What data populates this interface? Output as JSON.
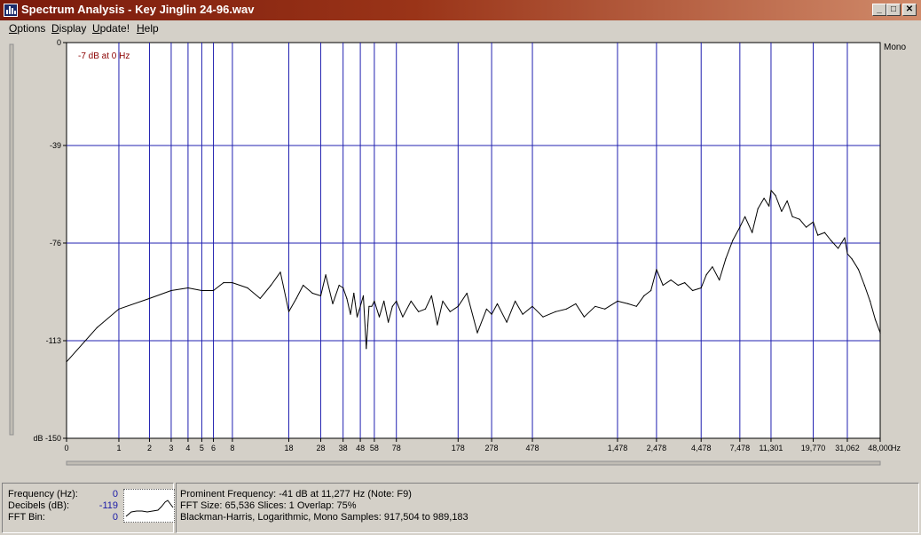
{
  "window": {
    "title": "Spectrum Analysis - Key Jinglin 24-96.wav",
    "minimize_glyph": "_",
    "maximize_glyph": "□",
    "close_glyph": "✕"
  },
  "menu": [
    {
      "label": "Options",
      "accel": "O",
      "rest": "ptions"
    },
    {
      "label": "Display",
      "accel": "D",
      "rest": "isplay"
    },
    {
      "label": "Update!",
      "accel": "U",
      "rest": "pdate!"
    },
    {
      "label": "Help",
      "accel": "H",
      "rest": "elp"
    }
  ],
  "plot": {
    "channel_label": "Mono",
    "annotation": "-7 dB at 0 Hz",
    "annotation_color": "#8b0000",
    "grid_color": "#2020b0",
    "line_color": "#000000",
    "background": "#ffffff"
  },
  "chart_data": {
    "type": "line",
    "title": "",
    "xlabel": "Hz",
    "ylabel": "dB",
    "x_scale": "log",
    "ylim": [
      -150,
      0
    ],
    "y_ticks": [
      0,
      -39,
      -76,
      -113,
      -150
    ],
    "y_tick_labels": [
      "0",
      "-39",
      "-76",
      "-113",
      "dB -150"
    ],
    "x_ticks": [
      0,
      1,
      2,
      3,
      4,
      5,
      6,
      8,
      18,
      28,
      38,
      48,
      58,
      78,
      178,
      278,
      478,
      1478,
      2478,
      4478,
      7478,
      11301,
      19770,
      31062,
      48000
    ],
    "x_tick_labels": [
      "0",
      "1",
      "2",
      "3",
      "4",
      "5",
      "6",
      "8",
      "18",
      "28",
      "38",
      "48",
      "58",
      "78",
      "178",
      "278",
      "478",
      "1,478",
      "2,478",
      "4,478",
      "7,478",
      "11,301",
      "19,770",
      "31,062",
      "48,000"
    ],
    "series": [
      {
        "x": [
          0,
          0.5,
          1,
          2,
          3,
          4,
          5,
          6,
          7,
          8,
          10,
          12,
          14,
          16,
          18,
          20,
          22,
          25,
          28,
          30,
          33,
          36,
          38,
          40,
          42,
          44,
          46,
          48,
          50,
          52,
          54,
          56,
          58,
          62,
          66,
          70,
          74,
          78,
          85,
          95,
          105,
          115,
          125,
          135,
          145,
          160,
          178,
          200,
          230,
          260,
          278,
          300,
          340,
          380,
          420,
          478,
          550,
          650,
          750,
          850,
          950,
          1100,
          1250,
          1478,
          1700,
          1900,
          2100,
          2300,
          2478,
          2700,
          3000,
          3300,
          3600,
          4000,
          4478,
          4800,
          5200,
          5700,
          6200,
          6800,
          7478,
          8000,
          8800,
          9500,
          10300,
          11000,
          11301,
          12000,
          13000,
          14000,
          15000,
          16500,
          18000,
          19770,
          21000,
          23000,
          25000,
          27500,
          30000,
          31062,
          33000,
          36000,
          39000,
          42000,
          45000,
          48000
        ],
        "values": [
          -121,
          -108,
          -101,
          -97,
          -94,
          -93,
          -94,
          -94,
          -91,
          -91,
          -93,
          -97,
          -92,
          -87,
          -102,
          -97,
          -92,
          -95,
          -96,
          -88,
          -99,
          -92,
          -93,
          -97,
          -103,
          -95,
          -104,
          -100,
          -96,
          -116,
          -100,
          -100,
          -98,
          -104,
          -98,
          -106,
          -100,
          -98,
          -104,
          -98,
          -102,
          -101,
          -96,
          -107,
          -98,
          -102,
          -100,
          -95,
          -110,
          -101,
          -103,
          -99,
          -106,
          -98,
          -103,
          -100,
          -104,
          -102,
          -101,
          -99,
          -104,
          -100,
          -101,
          -98,
          -99,
          -100,
          -96,
          -94,
          -86,
          -92,
          -90,
          -92,
          -91,
          -94,
          -93,
          -88,
          -85,
          -90,
          -82,
          -75,
          -70,
          -66,
          -72,
          -63,
          -59,
          -62,
          -56,
          -58,
          -64,
          -60,
          -66,
          -67,
          -70,
          -68,
          -73,
          -72,
          -75,
          -78,
          -74,
          -80,
          -82,
          -86,
          -92,
          -98,
          -105,
          -110
        ]
      }
    ]
  },
  "status": {
    "frequency_label": "Frequency (Hz):",
    "frequency_value": "0",
    "decibels_label": "Decibels (dB):",
    "decibels_value": "-119",
    "fft_bin_label": "FFT Bin:",
    "fft_bin_value": "0",
    "prominent_frequency": "Prominent Frequency: -41 dB at 11,277 Hz (Note: F9)",
    "fft_info": "FFT Size: 65,536  Slices: 1  Overlap: 75%",
    "window_info": "Blackman-Harris, Logarithmic, Mono  Samples: 917,504 to 989,183"
  }
}
